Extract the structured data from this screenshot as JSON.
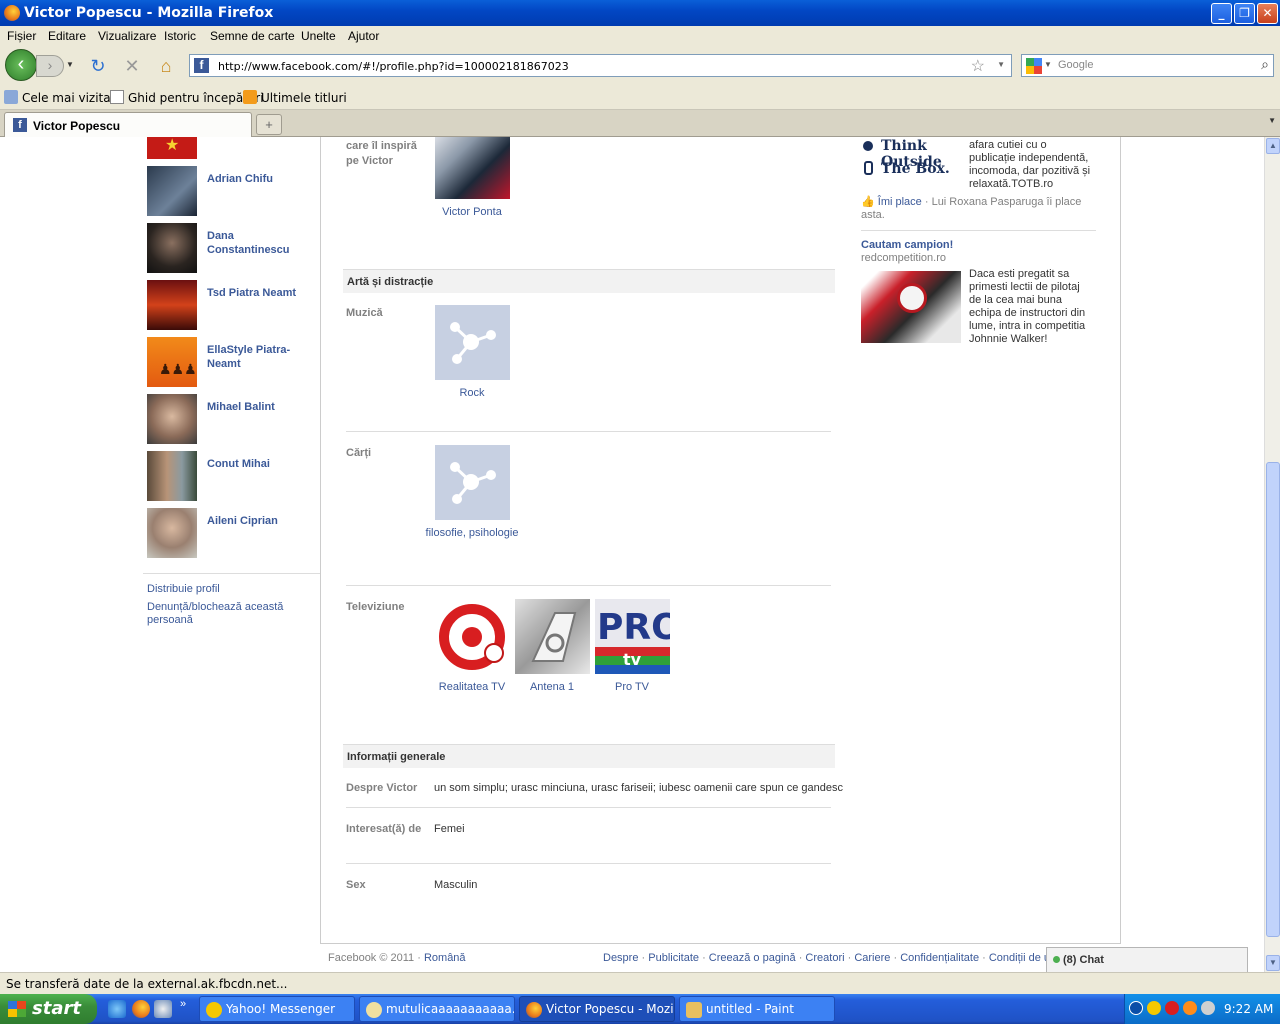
{
  "window": {
    "title": "Victor Popescu - Mozilla Firefox"
  },
  "menu": [
    "Fișier",
    "Editare",
    "Vizualizare",
    "Istoric",
    "Semne de carte",
    "Unelte",
    "Ajutor"
  ],
  "nav": {
    "url": "http://www.facebook.com/#!/profile.php?id=100002181867023",
    "search_placeholder": "Google"
  },
  "bookmarks": [
    "Cele mai vizitate",
    "Ghid pentru începători",
    "Ultimele titluri"
  ],
  "tab": {
    "title": "Victor Popescu",
    "new_tab": "+"
  },
  "friends": [
    "Adrian Chifu",
    "Dana Constantinescu",
    "Tsd Piatra Neamt",
    "EllaStyle Piatra-Neamt",
    "Mihael Balint",
    "Conut Mihai",
    "Aileni Ciprian"
  ],
  "left_links": {
    "share": "Distribuie profil",
    "report": "Denunță/blochează această persoană"
  },
  "inspire": {
    "label": "care îl inspiră pe Victor",
    "person": "Victor Ponta"
  },
  "arts": {
    "heading": "Artă și distracție",
    "music_label": "Muzică",
    "music_item": "Rock",
    "books_label": "Cărți",
    "books_item": "filosofie, psihologie",
    "tv_label": "Televiziune",
    "tv_items": [
      "Realitatea TV",
      "Antena 1",
      "Pro TV"
    ]
  },
  "general": {
    "heading": "Informații generale",
    "about_label": "Despre Victor",
    "about_value": "un som simplu; urasc minciuna, urasc fariseii; iubesc oamenii care spun ce gandesc",
    "interested_label": "Interesat(ă) de",
    "interested_value": "Femei",
    "sex_label": "Sex",
    "sex_value": "Masculin"
  },
  "ads": {
    "ad1_logo_line1": "Think Outside",
    "ad1_logo_line2": "The Box.",
    "ad1_text": "afara cutiei cu o publicație independentă, incomoda, dar pozitivă și relaxată.TOTB.ro",
    "ad1_like": "Îmi place",
    "ad1_like_rest": " · Lui Roxana Pasparuga îi place asta.",
    "ad2_title": "Cautam campion!",
    "ad2_domain": "redcompetition.ro",
    "ad2_text": "Daca esti pregatit sa primesti lectii de pilotaj de la cea mai buna echipa de instructori din lume, intra in competitia Johnnie Walker!"
  },
  "footer": {
    "copyright": "Facebook © 2011 · ",
    "language": "Română",
    "links": [
      "Despre",
      "Publicitate",
      "Creează o pagină",
      "Creatori",
      "Cariere",
      "Confidențialitate",
      "Condiții de ut"
    ]
  },
  "chat": {
    "count": "(8)",
    "label": "Chat"
  },
  "status": "Se transferă date de la external.ak.fbcdn.net...",
  "taskbar": {
    "start": "start",
    "items": [
      "Yahoo! Messenger",
      "mutulicaaaaaaaaaaa...",
      "Victor Popescu - Mozil...",
      "untitled - Paint"
    ],
    "clock": "9:22 AM"
  }
}
